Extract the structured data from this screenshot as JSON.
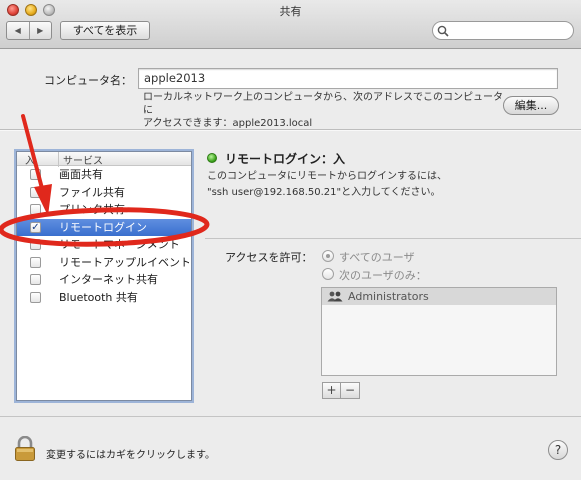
{
  "window": {
    "title": "共有"
  },
  "toolbar": {
    "back_glyph": "◀",
    "forward_glyph": "▶",
    "show_all_label": "すべてを表示",
    "search_placeholder": ""
  },
  "computer_name": {
    "label": "コンピュータ名：",
    "value": "apple2013",
    "description_line1": "ローカルネットワーク上のコンピュータから、次のアドレスでこのコンピュータに",
    "description_line2": "アクセスできます：apple2013.local",
    "edit_label": "編集..."
  },
  "services": {
    "header_on": "入",
    "header_service": "サービス",
    "items": [
      {
        "label": "画面共有",
        "checked": false,
        "selected": false
      },
      {
        "label": "ファイル共有",
        "checked": false,
        "selected": false
      },
      {
        "label": "プリンタ共有",
        "checked": false,
        "selected": false
      },
      {
        "label": "リモートログイン",
        "checked": true,
        "selected": true
      },
      {
        "label": "リモートマネージメント",
        "checked": false,
        "selected": false
      },
      {
        "label": "リモートアップルイベント",
        "checked": false,
        "selected": false
      },
      {
        "label": "インターネット共有",
        "checked": false,
        "selected": false
      },
      {
        "label": "Bluetooth 共有",
        "checked": false,
        "selected": false
      }
    ]
  },
  "detail": {
    "status": "リモートログイン：入",
    "instructions_line1": "このコンピュータにリモートからログインするには、",
    "instructions_line2": "\"ssh user@192.168.50.21\"と入力してください。",
    "access_label": "アクセスを許可：",
    "radio_all": "すべてのユーザ",
    "radio_only": "次のユーザのみ：",
    "users": [
      "Administrators"
    ],
    "add_label": "+",
    "remove_label": "−"
  },
  "footer": {
    "lock_message": "変更するにはカギをクリックします。",
    "help_label": "?"
  },
  "colors": {
    "selection": "#3a6fce",
    "annotation": "#e0281c",
    "status_on": "#3ca21c"
  },
  "icons": [
    "back-icon",
    "forward-icon",
    "search-icon",
    "status-green-icon",
    "group-icon",
    "lock-icon",
    "help-icon",
    "annotation-arrow",
    "annotation-ellipse"
  ]
}
